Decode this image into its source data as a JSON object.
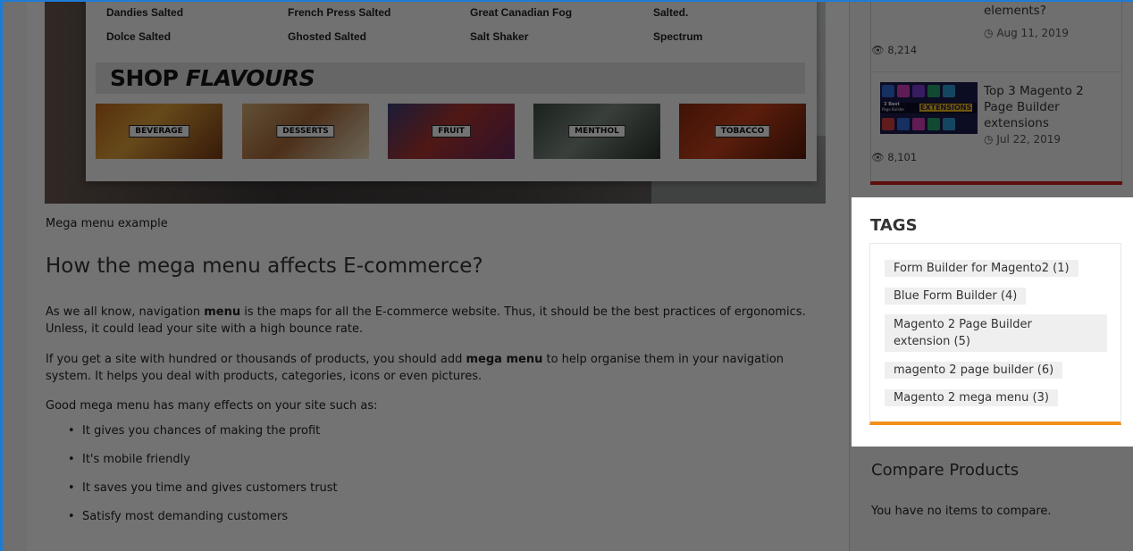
{
  "mega_menu_image": {
    "items_row1": [
      "Dandies Salted",
      "French Press Salted",
      "Great Canadian Fog",
      "Salted."
    ],
    "items_row2": [
      "Dolce Salted",
      "Ghosted Salted",
      "Salt Shaker",
      "Spectrum"
    ],
    "banner_main": "SHOP",
    "banner_italic": "FLAVOURS",
    "tiles": [
      "BEVERAGE",
      "DESSERTS",
      "FRUIT",
      "MENTHOL",
      "TOBACCO"
    ]
  },
  "article": {
    "caption": "Mega menu example",
    "heading": "How the mega menu affects E-commerce?",
    "p1_a": "As we all know, navigation ",
    "p1_b": "menu",
    "p1_c": " is the maps for all the E-commerce website. Thus, it should be the best practices of ergonomics. Unless, it could lead your site with a high bounce rate.",
    "p2_a": "If you get a site with hundred or thousands of products, you should add ",
    "p2_b": "mega menu",
    "p2_c": " to help organise them in your navigation system. It helps you deal with products, categories, icons or even pictures.",
    "p3": "Good mega menu has many effects on your site such as:",
    "bullets": [
      "It gives you chances of making the profit",
      "It's mobile friendly",
      "It saves you time and gives customers trust",
      "Satisfy most demanding customers"
    ]
  },
  "sidebar": {
    "post1": {
      "title": "elements?",
      "date": "Aug 11, 2019",
      "views": "8,214"
    },
    "post2": {
      "title_line1": "Top 3 Magento 2",
      "title_line2": "Page Builder",
      "title_line3": "extensions",
      "date": "Jul 22, 2019",
      "views": "8,101",
      "thumb_text1": "3 Best",
      "thumb_text2": "Page Builder",
      "thumb_text3": "EXTENSIONS"
    },
    "tags_title": "TAGS",
    "tags": [
      "Form Builder for Magento2 (1)",
      "Blue Form Builder (4)",
      "Magento 2 Page Builder",
      "extension (5)",
      "magento 2 page builder (6)",
      "Magento 2 mega menu (3)"
    ],
    "compare_title": "Compare Products",
    "compare_text": "You have no items to compare."
  },
  "colors": {
    "frame_border": "#1e7bd6",
    "accent_orange": "#f08f1b",
    "accent_red": "#d21d1d",
    "overlay": "rgba(0,0,0,0.55)"
  },
  "icons": [
    "eye-icon",
    "clock-icon"
  ]
}
